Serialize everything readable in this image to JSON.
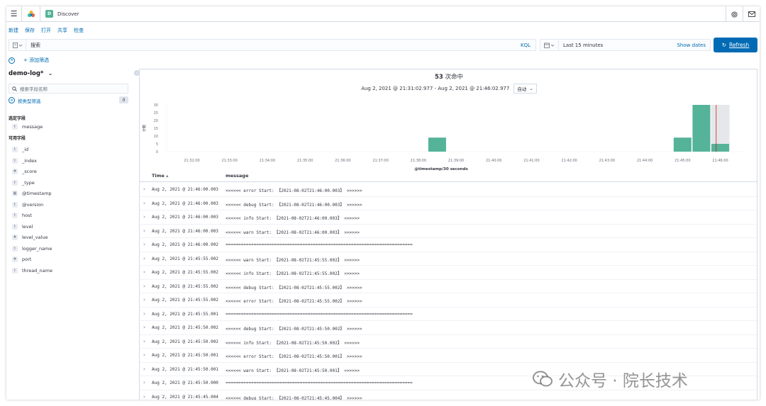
{
  "header": {
    "space_initial": "D",
    "breadcrumb": "Discover"
  },
  "top_menu": [
    "新建",
    "保存",
    "打开",
    "共享",
    "检查"
  ],
  "query": {
    "placeholder": "搜索",
    "language": "KQL"
  },
  "time": {
    "range": "Last 15 minutes",
    "show_dates": "Show dates",
    "refresh": "Refresh"
  },
  "filters": {
    "add": "+ 添加筛选"
  },
  "sidebar": {
    "index_pattern": "demo-log*",
    "search_placeholder": "搜索字段名称",
    "filter_by_type": "按类型筛选",
    "filter_count": "0",
    "selected_header": "选定字段",
    "selected_fields": [
      {
        "type": "t",
        "name": "message"
      }
    ],
    "available_header": "可用字段",
    "available_fields": [
      {
        "type": "t",
        "name": "_id"
      },
      {
        "type": "t",
        "name": "_index"
      },
      {
        "type": "#",
        "name": "_score"
      },
      {
        "type": "t",
        "name": "_type"
      },
      {
        "type": "cal",
        "name": "@timestamp"
      },
      {
        "type": "t",
        "name": "@version"
      },
      {
        "type": "t",
        "name": "host"
      },
      {
        "type": "t",
        "name": "level"
      },
      {
        "type": "#",
        "name": "level_value"
      },
      {
        "type": "t",
        "name": "logger_name"
      },
      {
        "type": "#",
        "name": "port"
      },
      {
        "type": "t",
        "name": "thread_name"
      }
    ]
  },
  "results": {
    "hit_count": "53",
    "hit_label": "次命中",
    "date_range": "Aug 2, 2021 @ 21:31:02.977 - Aug 2, 2021 @ 21:46:02.977",
    "interval": "自动"
  },
  "chart_data": {
    "type": "bar",
    "ylabel": "计数",
    "xlabel": "@timestamp/30 seconds",
    "ylim": [
      0,
      30
    ],
    "yticks": [
      0,
      5,
      10,
      15,
      20,
      25,
      30
    ],
    "x_ticks": [
      "21:32:00",
      "21:33:00",
      "21:34:00",
      "21:35:00",
      "21:36:00",
      "21:37:00",
      "21:38:00",
      "21:39:00",
      "21:40:00",
      "21:41:00",
      "21:42:00",
      "21:43:00",
      "21:44:00",
      "21:45:00",
      "21:46:00"
    ],
    "bars": [
      {
        "x": "21:38:30",
        "value": 9
      },
      {
        "x": "21:45:00",
        "value": 9
      },
      {
        "x": "21:45:30",
        "value": 30
      },
      {
        "x": "21:46:00",
        "value": 5
      }
    ],
    "bar_color": "#54b399",
    "partial_bucket_color": "#e0e1e6",
    "now_marker_color": "#bd271e"
  },
  "table": {
    "columns": [
      "Time",
      "message"
    ],
    "rows": [
      {
        "time": "Aug 2, 2021 @ 21:46:00.003",
        "message": "<<<<<< error Start: 【2021-08-02T21:46:00.003】 >>>>>>"
      },
      {
        "time": "Aug 2, 2021 @ 21:46:00.003",
        "message": "<<<<<< debug Start: 【2021-08-02T21:46:00.003】 >>>>>>"
      },
      {
        "time": "Aug 2, 2021 @ 21:46:00.003",
        "message": "<<<<<< info Start: 【2021-08-02T21:46:00.003】 >>>>>>"
      },
      {
        "time": "Aug 2, 2021 @ 21:46:00.003",
        "message": "<<<<<< warn Start: 【2021-08-02T21:46:00.003】 >>>>>>"
      },
      {
        "time": "Aug 2, 2021 @ 21:46:00.002",
        "message": "========================================================================="
      },
      {
        "time": "Aug 2, 2021 @ 21:45:55.002",
        "message": "<<<<<< warn Start: 【2021-08-02T21:45:55.002】 >>>>>>"
      },
      {
        "time": "Aug 2, 2021 @ 21:45:55.002",
        "message": "<<<<<< info Start: 【2021-08-02T21:45:55.002】 >>>>>>"
      },
      {
        "time": "Aug 2, 2021 @ 21:45:55.002",
        "message": "<<<<<< debug Start: 【2021-08-02T21:45:55.002】 >>>>>>"
      },
      {
        "time": "Aug 2, 2021 @ 21:45:55.002",
        "message": "<<<<<< error Start: 【2021-08-02T21:45:55.002】 >>>>>>"
      },
      {
        "time": "Aug 2, 2021 @ 21:45:55.001",
        "message": "========================================================================="
      },
      {
        "time": "Aug 2, 2021 @ 21:45:50.002",
        "message": "<<<<<< debug Start: 【2021-08-02T21:45:50.002】 >>>>>>"
      },
      {
        "time": "Aug 2, 2021 @ 21:45:50.002",
        "message": "<<<<<< info Start: 【2021-08-02T21:45:50.002】 >>>>>>"
      },
      {
        "time": "Aug 2, 2021 @ 21:45:50.001",
        "message": "<<<<<< error Start: 【2021-08-02T21:45:50.001】 >>>>>>"
      },
      {
        "time": "Aug 2, 2021 @ 21:45:50.001",
        "message": "<<<<<< warn Start: 【2021-08-02T21:45:50.001】 >>>>>>"
      },
      {
        "time": "Aug 2, 2021 @ 21:45:50.000",
        "message": "========================================================================="
      },
      {
        "time": "Aug 2, 2021 @ 21:45:45.004",
        "message": "<<<<<< debug Start: 【2021-08-02T21:45:45.004】 >>>>>>"
      }
    ]
  },
  "watermark": {
    "text": "公众号 · 院长技术"
  }
}
